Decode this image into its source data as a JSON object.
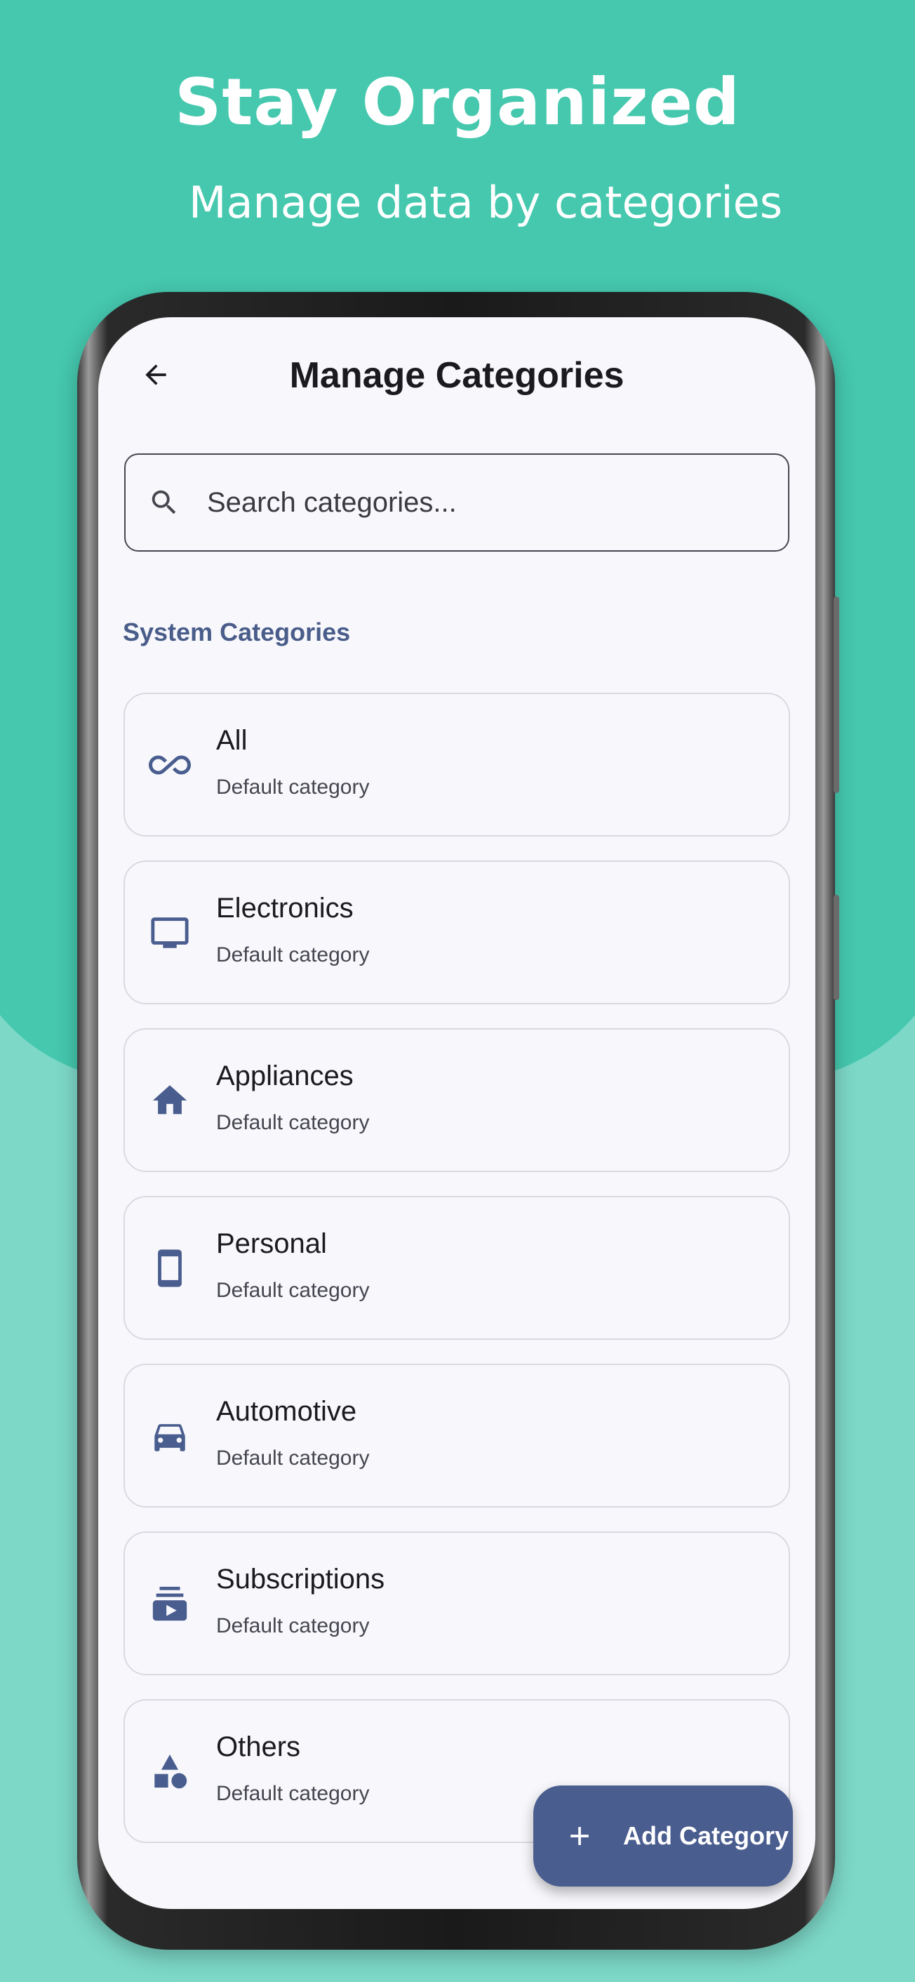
{
  "promo": {
    "title": "Stay Organized",
    "subtitle": "Manage data by categories"
  },
  "header": {
    "title": "Manage Categories",
    "back_icon": "arrow-back-icon"
  },
  "search": {
    "placeholder": "Search categories...",
    "value": "",
    "icon": "search-icon"
  },
  "section": {
    "label": "System Categories"
  },
  "categories": [
    {
      "name": "All",
      "description": "Default category",
      "icon": "infinity-icon"
    },
    {
      "name": "Electronics",
      "description": "Default category",
      "icon": "tv-icon"
    },
    {
      "name": "Appliances",
      "description": "Default category",
      "icon": "home-icon"
    },
    {
      "name": "Personal",
      "description": "Default category",
      "icon": "smartphone-icon"
    },
    {
      "name": "Automotive",
      "description": "Default category",
      "icon": "car-icon"
    },
    {
      "name": "Subscriptions",
      "description": "Default category",
      "icon": "subscriptions-icon"
    },
    {
      "name": "Others",
      "description": "Default category",
      "icon": "shapes-icon"
    }
  ],
  "fab": {
    "label": "Add Category",
    "icon": "plus-icon"
  },
  "colors": {
    "accent": "#4a5d8f",
    "background_top": "#45c8ae",
    "background_bottom": "#7dd8c8",
    "screen": "#f8f8fc"
  }
}
